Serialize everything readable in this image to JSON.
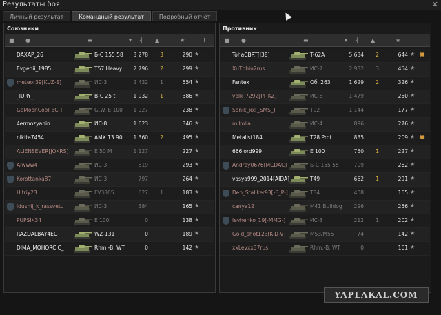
{
  "window": {
    "title": "Результаты боя",
    "close_glyph": "✕"
  },
  "tabs": [
    {
      "label": "Личный результат",
      "active": false
    },
    {
      "label": "Командный результат",
      "active": true
    },
    {
      "label": "Подробный отчёт",
      "active": false
    }
  ],
  "allies": {
    "title": "Союзники",
    "rows": [
      {
        "player": "DAXAP_26",
        "tank": "Б-С 155 58",
        "damage": "3 278",
        "kills": "3",
        "xp": "290",
        "dead": false,
        "clan": false
      },
      {
        "player": "Evgenii_1985",
        "tank": "T57 Heavy",
        "damage": "2 796",
        "kills": "2",
        "xp": "299",
        "dead": false,
        "clan": false
      },
      {
        "player": "meteor39[KUZ-S]",
        "tank": "ИС-3",
        "damage": "2 432",
        "kills": "1",
        "xp": "554",
        "dead": true,
        "clan": true
      },
      {
        "player": "_IURY_",
        "tank": "B-C 25 t",
        "damage": "1 932",
        "kills": "1",
        "xp": "386",
        "dead": false,
        "clan": false
      },
      {
        "player": "GoMoonCool[BC-]",
        "tank": "G.W. E 100",
        "damage": "1 927",
        "kills": "",
        "xp": "238",
        "dead": true,
        "clan": false
      },
      {
        "player": "4ermozyanin",
        "tank": "ИС-8",
        "damage": "1 623",
        "kills": "",
        "xp": "346",
        "dead": false,
        "clan": false
      },
      {
        "player": "nikita7454",
        "tank": "AMX 13 90",
        "damage": "1 360",
        "kills": "2",
        "xp": "495",
        "dead": false,
        "clan": false
      },
      {
        "player": "ALIENSEVER[JOKRS]",
        "tank": "E 50 M",
        "damage": "1 127",
        "kills": "",
        "xp": "227",
        "dead": true,
        "clan": false
      },
      {
        "player": "Alwww4",
        "tank": "ИС-3",
        "damage": "819",
        "kills": "",
        "xp": "293",
        "dead": true,
        "clan": true
      },
      {
        "player": "Korottanka87",
        "tank": "ИС-3",
        "damage": "797",
        "kills": "",
        "xp": "264",
        "dead": true,
        "clan": true
      },
      {
        "player": "Hitriy23",
        "tank": "FV3805",
        "damage": "627",
        "kills": "1",
        "xp": "183",
        "dead": true,
        "clan": false
      },
      {
        "player": "idushij_k_rassvetu",
        "tank": "ИС-3",
        "damage": "384",
        "kills": "",
        "xp": "165",
        "dead": true,
        "clan": true
      },
      {
        "player": "PUPSIK34",
        "tank": "E 100",
        "damage": "0",
        "kills": "",
        "xp": "138",
        "dead": true,
        "clan": false
      },
      {
        "player": "RAZDALBAY4EG",
        "tank": "WZ-131",
        "damage": "0",
        "kills": "",
        "xp": "189",
        "dead": false,
        "clan": false
      },
      {
        "player": "DIMA_MOHORCIC_",
        "tank": "Rhm.-B. WT",
        "damage": "0",
        "kills": "",
        "xp": "142",
        "dead": false,
        "clan": false
      }
    ]
  },
  "enemies": {
    "title": "Противник",
    "rows": [
      {
        "player": "TohaCBRT[I38]",
        "tank": "T-62A",
        "damage": "5 634",
        "kills": "2",
        "xp": "644",
        "dead": false,
        "clan": false,
        "medal": true
      },
      {
        "player": "XuTpblu2rus",
        "tank": "ИС-7",
        "damage": "2 932",
        "kills": "3",
        "xp": "454",
        "dead": true,
        "clan": false
      },
      {
        "player": "Fantex",
        "tank": "Об. 263",
        "damage": "1 629",
        "kills": "2",
        "xp": "326",
        "dead": false,
        "clan": false
      },
      {
        "player": "volk_7292[PI_KZ]",
        "tank": "ИС-8",
        "damage": "1 479",
        "kills": "",
        "xp": "250",
        "dead": true,
        "clan": false
      },
      {
        "player": "Sonik_xx[_SMS_]",
        "tank": "T92",
        "damage": "1 144",
        "kills": "",
        "xp": "177",
        "dead": true,
        "clan": true
      },
      {
        "player": "mikolla",
        "tank": "ИС-4",
        "damage": "896",
        "kills": "",
        "xp": "276",
        "dead": true,
        "clan": false
      },
      {
        "player": "Metalist184",
        "tank": "T28 Prot.",
        "damage": "835",
        "kills": "",
        "xp": "209",
        "dead": false,
        "clan": false,
        "medal": true
      },
      {
        "player": "666lord999",
        "tank": "E 100",
        "damage": "750",
        "kills": "1",
        "xp": "227",
        "dead": false,
        "clan": false
      },
      {
        "player": "Andrey0676[MCDAC]",
        "tank": "Б-С 155 55",
        "damage": "709",
        "kills": "",
        "xp": "262",
        "dead": true,
        "clan": true
      },
      {
        "player": "vasya999_2014[AIDA]",
        "tank": "T49",
        "damage": "662",
        "kills": "1",
        "xp": "291",
        "dead": false,
        "clan": false
      },
      {
        "player": "Den_StaLker93[-E_P-]",
        "tank": "T34",
        "damage": "408",
        "kills": "",
        "xp": "165",
        "dead": true,
        "clan": true
      },
      {
        "player": "canya12",
        "tank": "M41 Bulldog",
        "damage": "296",
        "kills": "",
        "xp": "256",
        "dead": true,
        "clan": false
      },
      {
        "player": "levhenko_19[-MMG-]",
        "tank": "ИС-3",
        "damage": "212",
        "kills": "1",
        "xp": "202",
        "dead": true,
        "clan": true
      },
      {
        "player": "Gold_shot123[K-D-V]",
        "tank": "M53/M55",
        "damage": "74",
        "kills": "",
        "xp": "142",
        "dead": true,
        "clan": false
      },
      {
        "player": "xxLevxx37rus",
        "tank": "Rhm.-B. WT",
        "damage": "0",
        "kills": "",
        "xp": "161",
        "dead": true,
        "clan": false
      }
    ]
  },
  "icons": {
    "star": "★",
    "medal": "✸",
    "clan_badge": "shield"
  },
  "watermark": "YAPLAKAL.COM"
}
